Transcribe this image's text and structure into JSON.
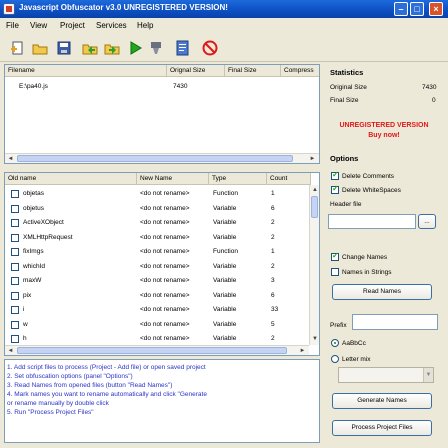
{
  "window": {
    "title": "Javascript Obfuscator v3.0  UNREGISTERED VERSION!",
    "min_glyph": "–",
    "max_glyph": "□",
    "close_glyph": "×"
  },
  "menu": [
    "File",
    "View",
    "Project",
    "Services",
    "Help"
  ],
  "toolbar_icons": [
    "add-file-icon",
    "open-icon",
    "save-icon",
    "export-icon",
    "import-icon",
    "run-icon",
    "filter-icon",
    "document-icon",
    "stop-icon"
  ],
  "files_table": {
    "headers": [
      "Filename",
      "Orignal Size",
      "Final Size",
      "Compress"
    ],
    "rows": [
      {
        "filename": "E:\\pa40.js",
        "original": "7430",
        "final": "",
        "compress": ""
      }
    ]
  },
  "names_table": {
    "headers": [
      "Old name",
      "New Name",
      "Type",
      "Count"
    ],
    "rows": [
      {
        "old": "objetas",
        "new": "<do not rename>",
        "type": "Function",
        "count": "1"
      },
      {
        "old": "objetus",
        "new": "<do not rename>",
        "type": "Variable",
        "count": "6"
      },
      {
        "old": "ActiveXObject",
        "new": "<do not rename>",
        "type": "Variable",
        "count": "2"
      },
      {
        "old": "XMLHttpRequest",
        "new": "<do not rename>",
        "type": "Variable",
        "count": "2"
      },
      {
        "old": "fixImgs",
        "new": "<do not rename>",
        "type": "Function",
        "count": "1"
      },
      {
        "old": "whichId",
        "new": "<do not rename>",
        "type": "Variable",
        "count": "2"
      },
      {
        "old": "maxW",
        "new": "<do not rename>",
        "type": "Variable",
        "count": "3"
      },
      {
        "old": "pix",
        "new": "<do not rename>",
        "type": "Variable",
        "count": "6"
      },
      {
        "old": "i",
        "new": "<do not rename>",
        "type": "Variable",
        "count": "33"
      },
      {
        "old": "w",
        "new": "<do not rename>",
        "type": "Variable",
        "count": "5"
      },
      {
        "old": "h",
        "new": "<do not rename>",
        "type": "Variable",
        "count": "2"
      }
    ]
  },
  "instructions": [
    "1. Add script files to process (Project - Add file) or open saved project",
    "2. Set obfuscation options (panel \"Options\")",
    "3. Read Names from opened files (button \"Read Names\")",
    "4. Mark names you want to rename automatically and click \"Generate",
    "   or rename manually by double click",
    "5. Run \"Process Project Files\""
  ],
  "statistics": {
    "title": "Statistics",
    "original_label": "Original Size",
    "original_value": "7430",
    "final_label": "Final Size",
    "final_value": "0",
    "unregistered_line1": "UNREGISTERED VERSION",
    "unregistered_line2": "Buy now!"
  },
  "options": {
    "title": "Options",
    "delete_comments": "Delete Comments",
    "delete_whitespaces": "Delete WhiteSpaces",
    "header_file_label": "Header file",
    "browse_label": "...",
    "change_names": "Change Names",
    "names_in_strings": "Names in Strings",
    "read_names_button": "Read Names",
    "prefix_label": "Prefix",
    "radio_aabbcc": "AaBbCc",
    "radio_letter_mix": "Letter mix",
    "generate_names_button": "Generate Names",
    "process_button": "Process Project Files"
  }
}
